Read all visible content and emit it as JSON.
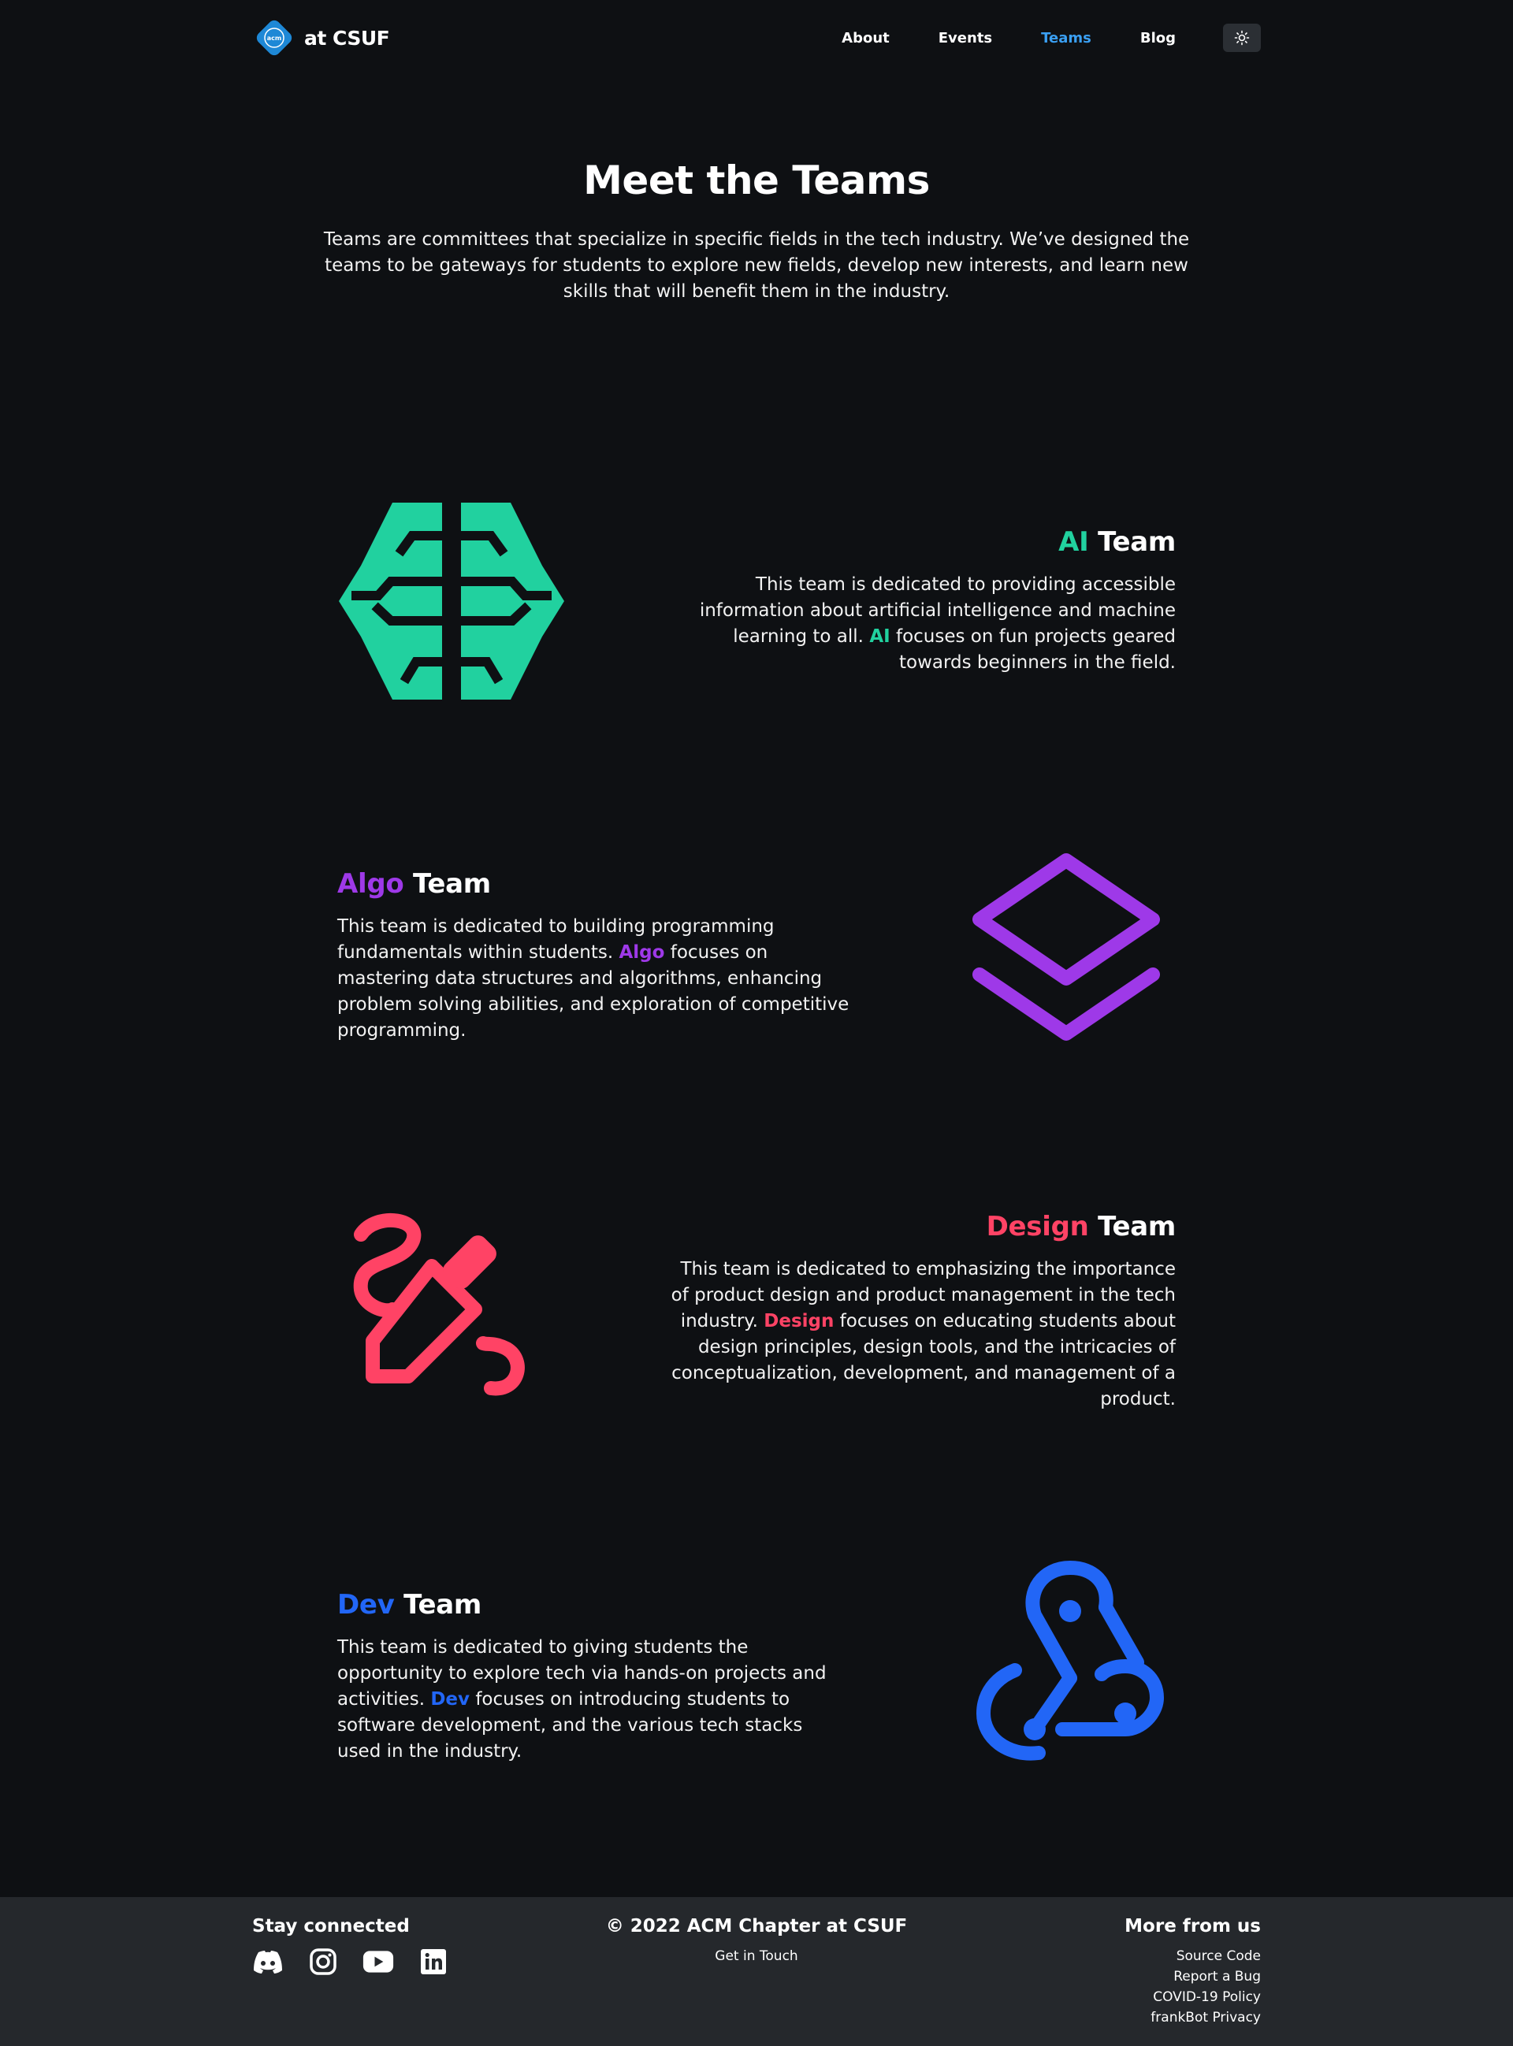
{
  "nav": {
    "brand": "at CSUF",
    "logo_text": "acm",
    "links": [
      {
        "label": "About"
      },
      {
        "label": "Events"
      },
      {
        "label": "Teams"
      },
      {
        "label": "Blog"
      }
    ],
    "active": "Teams",
    "theme_icon": "sun-icon"
  },
  "hero": {
    "title": "Meet the Teams",
    "description": "Teams are committees that specialize in specific fields in the tech industry. We’ve designed the teams to be gateways for students to explore new fields, develop new interests, and learn new skills that will benefit them in the industry."
  },
  "teams": [
    {
      "name": "AI",
      "suffix": " Team",
      "color": "#21d19f",
      "icon": "brain-icon",
      "desc_before": "This team is dedicated to providing accessible information about artificial intelligence and machine learning to all. ",
      "desc_highlight": "AI",
      "desc_after": " focuses on fun projects geared towards beginners in the field."
    },
    {
      "name": "Algo",
      "suffix": " Team",
      "color": "#9e39e8",
      "icon": "layers-icon",
      "desc_before": "This team is dedicated to building programming fundamentals within students. ",
      "desc_highlight": "Algo",
      "desc_after": " focuses on mastering data structures and algorithms, enhancing problem solving abilities, and exploration of competitive programming."
    },
    {
      "name": "Design",
      "suffix": " Team",
      "color": "#ff4365",
      "icon": "pencil-icon",
      "desc_before": "This team is dedicated to emphasizing the importance of product design and product management in the tech industry. ",
      "desc_highlight": "Design",
      "desc_after": " focuses on educating students about design principles, design tools, and the intricacies of conceptualization, development, and management of a product."
    },
    {
      "name": "Dev",
      "suffix": " Team",
      "color": "#2266f6",
      "icon": "webhook-icon",
      "desc_before": "This team is dedicated to giving students the opportunity to explore tech via hands-on projects and activities. ",
      "desc_highlight": "Dev",
      "desc_after": " focuses on introducing students to software development, and the various tech stacks used in the industry."
    }
  ],
  "footer": {
    "left_title": "Stay connected",
    "socials": [
      "discord-icon",
      "instagram-icon",
      "youtube-icon",
      "linkedin-icon"
    ],
    "mid_title": "© 2022 ACM Chapter at CSUF",
    "mid_link": "Get in Touch",
    "right_title": "More from us",
    "right_links": [
      "Source Code",
      "Report a Bug",
      "COVID-19 Policy",
      "frankBot Privacy"
    ]
  }
}
